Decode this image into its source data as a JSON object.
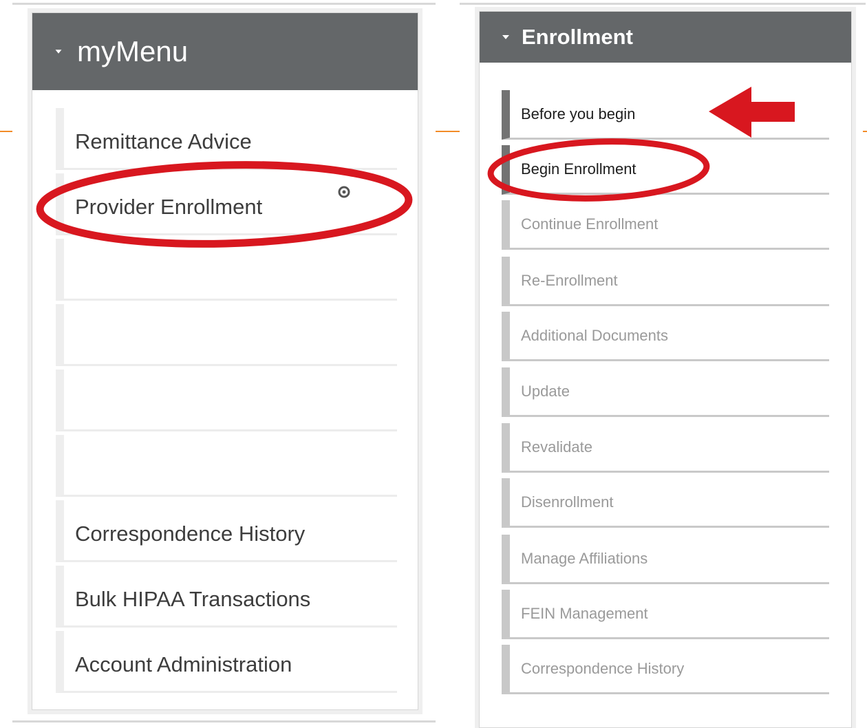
{
  "left_menu": {
    "title": "myMenu",
    "items": [
      {
        "label": "Remittance Advice"
      },
      {
        "label": "Provider Enrollment"
      },
      {
        "label": ""
      },
      {
        "label": ""
      },
      {
        "label": ""
      },
      {
        "label": ""
      },
      {
        "label": "Correspondence History"
      },
      {
        "label": "Bulk HIPAA Transactions"
      },
      {
        "label": "Account Administration"
      }
    ]
  },
  "right_menu": {
    "title": "Enrollment",
    "items": [
      {
        "label": "Before you begin"
      },
      {
        "label": "Begin Enrollment"
      },
      {
        "label": "Continue Enrollment"
      },
      {
        "label": "Re-Enrollment"
      },
      {
        "label": "Additional Documents"
      },
      {
        "label": "Update"
      },
      {
        "label": "Revalidate"
      },
      {
        "label": "Disenrollment"
      },
      {
        "label": "Manage Affiliations"
      },
      {
        "label": "FEIN Management"
      },
      {
        "label": "Correspondence History"
      }
    ]
  },
  "colors": {
    "header_bg": "#646769",
    "annotation_red": "#d8171f",
    "accent_orange": "#f28c28"
  },
  "icons": [
    "caret-down-icon",
    "gear-cursor-icon",
    "annotation-arrow-icon"
  ]
}
